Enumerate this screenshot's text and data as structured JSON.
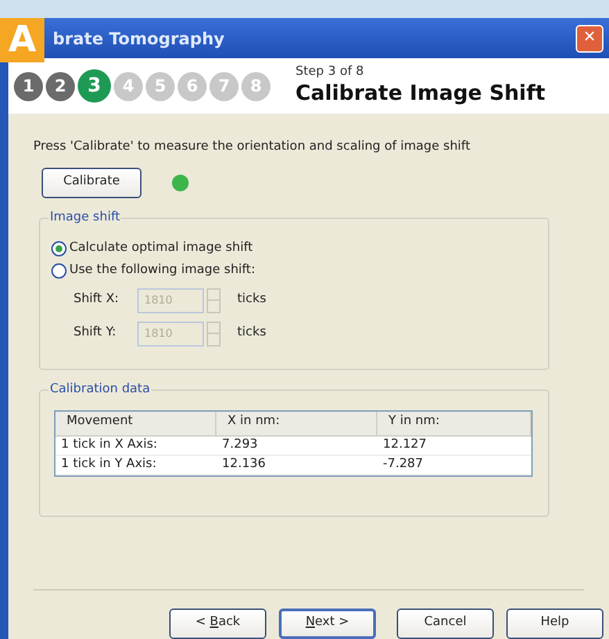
{
  "badge": "A",
  "window": {
    "title": "brate Tomography",
    "close": "✕"
  },
  "steps": [
    {
      "label": "1",
      "kind": "done"
    },
    {
      "label": "2",
      "kind": "done"
    },
    {
      "label": "3",
      "kind": "current"
    },
    {
      "label": "4",
      "kind": "upcoming"
    },
    {
      "label": "5",
      "kind": "upcoming"
    },
    {
      "label": "6",
      "kind": "upcoming"
    },
    {
      "label": "7",
      "kind": "upcoming"
    },
    {
      "label": "8",
      "kind": "upcoming"
    }
  ],
  "step_caption": "Step 3 of 8",
  "step_title": "Calibrate Image Shift",
  "instruction": "Press 'Calibrate' to measure the orientation and scaling  of image shift",
  "calibrate_button": "Calibrate",
  "status_light": {
    "color": "#3cb54a"
  },
  "image_shift": {
    "title": "Image shift",
    "options": [
      {
        "label": "Calculate optimal image shift",
        "selected": true
      },
      {
        "label": "Use the following image shift:",
        "selected": false
      }
    ],
    "fields": [
      {
        "label": "Shift X:",
        "value": "1810",
        "unit": "ticks",
        "disabled": true
      },
      {
        "label": "Shift Y:",
        "value": "1810",
        "unit": "ticks",
        "disabled": true
      }
    ]
  },
  "calibration_data": {
    "title": "Calibration data",
    "columns": [
      "Movement",
      "X in nm:",
      "Y in nm:"
    ],
    "rows": [
      [
        "1 tick in X Axis:",
        "7.293",
        "12.127"
      ],
      [
        "1 tick in Y Axis:",
        "12.136",
        "-7.287"
      ]
    ]
  },
  "buttons": [
    {
      "before": "< ",
      "key": "B",
      "after": "ack",
      "default": false
    },
    {
      "key": "N",
      "after": "ext >",
      "default": true
    },
    {
      "before": "Cancel",
      "default": false
    },
    {
      "before": "Help",
      "default": false
    }
  ]
}
